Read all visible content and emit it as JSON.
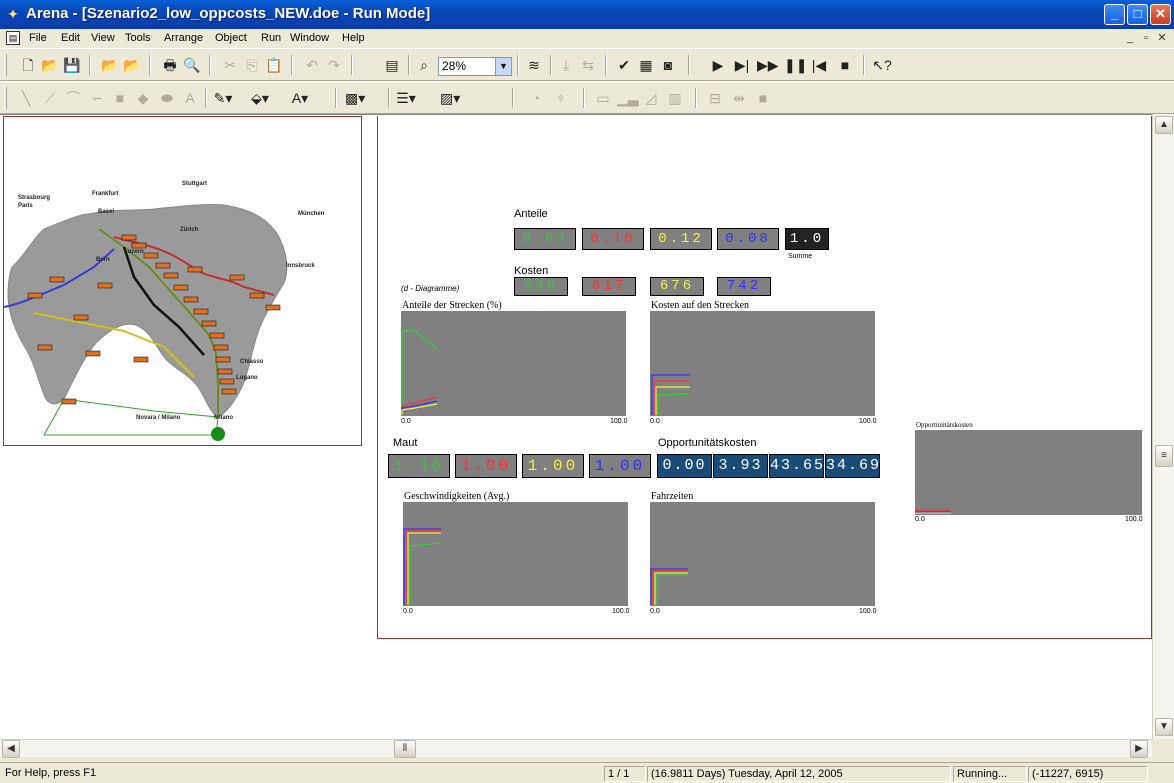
{
  "window": {
    "title": "Arena - [Szenario2_low_oppcosts_NEW.doe - Run Mode]",
    "minimize_label": "_",
    "maximize_label": "□",
    "close_label": "✕"
  },
  "menu": {
    "items": [
      "File",
      "Edit",
      "View",
      "Tools",
      "Arrange",
      "Object",
      "Run",
      "Window",
      "Help"
    ],
    "mdi_controls": [
      "_",
      "▫",
      "✕"
    ]
  },
  "toolbar": {
    "zoom_value": "28%"
  },
  "map": {
    "cities": [
      "Strasbourg",
      "Paris",
      "Frankfurt",
      "Stuttgart",
      "München",
      "Basel",
      "Zürich",
      "Luzern",
      "Bern",
      "Innsbruck",
      "Chiasso",
      "Lugano",
      "Novara / Milano",
      "Milano"
    ]
  },
  "dashboard": {
    "anteile_label": "Anteile",
    "anteile_values": [
      {
        "text": "0.63",
        "color": "#40c040"
      },
      {
        "text": "0.18",
        "color": "#ff3030"
      },
      {
        "text": "0.12",
        "color": "#f0f040"
      },
      {
        "text": "0.08",
        "color": "#3030ff"
      }
    ],
    "summe_value": "1.0",
    "summe_label": "Summe",
    "kosten_label": "Kosten",
    "diagram_note": "(d - Diagramme)",
    "kosten_values": [
      {
        "text": "536",
        "color": "#40c040"
      },
      {
        "text": "617",
        "color": "#ff3030"
      },
      {
        "text": "676",
        "color": "#f0f040"
      },
      {
        "text": "742",
        "color": "#3030ff"
      }
    ],
    "maut_label": "Maut",
    "maut_values": [
      {
        "text": "1.16",
        "color": "#40c040"
      },
      {
        "text": "1.00",
        "color": "#ff3030"
      },
      {
        "text": "1.00",
        "color": "#f0f040"
      },
      {
        "text": "1.00",
        "color": "#3030ff"
      }
    ],
    "opp_label": "Opportunitätskosten",
    "opp_values": [
      "0.00",
      "3.93",
      "43.65",
      "34.69"
    ],
    "charts": {
      "anteile": {
        "title": "Anteile der Strecken (%)",
        "x_start": "0.0",
        "x_end": "100.0"
      },
      "kosten": {
        "title": "Kosten auf den Strecken",
        "x_start": "0.0",
        "x_end": "100.0"
      },
      "opp": {
        "title": "Opportunitätskosten",
        "x_start": "0.0",
        "x_end": "100.0"
      },
      "geschw": {
        "title": "Geschwindigkeiten (Avg.)",
        "x_start": "0.0",
        "x_end": "100.0"
      },
      "fahrzeiten": {
        "title": "Fahrzeiten",
        "x_start": "0.0",
        "x_end": "100.0"
      }
    }
  },
  "statusbar": {
    "help": "For Help, press F1",
    "page": "1 / 1",
    "time": "(16.9811 Days) Tuesday, April 12, 2005",
    "state": "Running...",
    "coords": "(-11227, 6915)"
  }
}
